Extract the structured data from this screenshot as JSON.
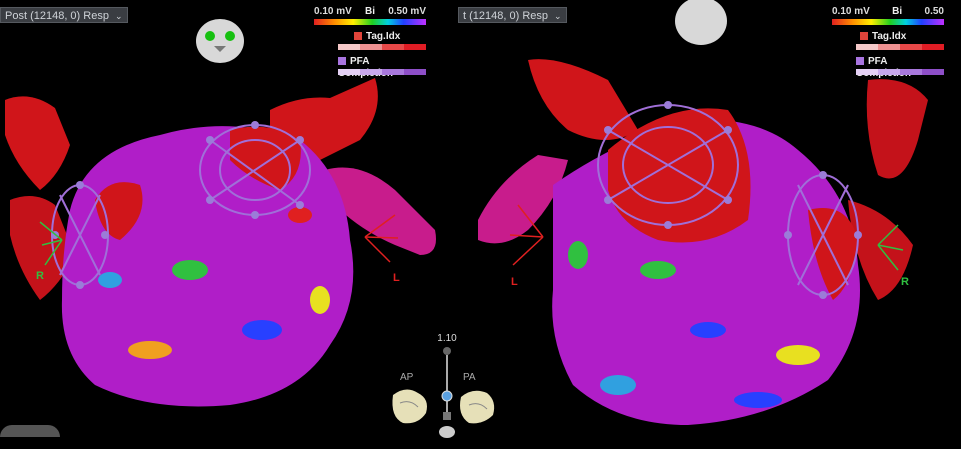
{
  "map_select": {
    "left_label": "Post (12148, 0) Resp",
    "right_label": "t (12148, 0) Resp"
  },
  "bi_legend": {
    "title": "Bi",
    "min": "0.10 mV",
    "max_left": "0.50 mV",
    "max_right": "0.50"
  },
  "tag_legend": {
    "label": "Tag.Idx"
  },
  "pfa_legend": {
    "label": "PFA Completion"
  },
  "orientation": {
    "left_side": "R",
    "right_side": "L",
    "right_left_side": "L",
    "right_right_side": "R"
  },
  "zoom": {
    "value": "1.10"
  },
  "views": {
    "ap": "AP",
    "pa": "PA"
  },
  "colors": {
    "tissue_healthy": "#b01ec8",
    "tissue_scar": "#d0151a",
    "catheter": "#9b7cd8",
    "tag_red": "#e01c24",
    "pfa_purple": "#8e4fc8"
  }
}
